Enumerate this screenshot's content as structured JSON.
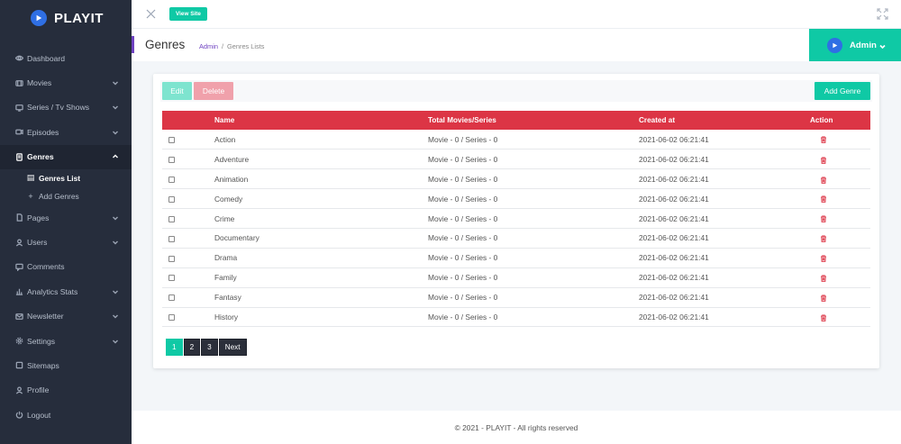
{
  "brand": {
    "name": "PLAYIT",
    "color": "#2f6fe4"
  },
  "sidebar": {
    "items": [
      {
        "label": "Dashboard",
        "icon": "eye-icon",
        "has_chevron": false
      },
      {
        "label": "Movies",
        "icon": "film-icon",
        "has_chevron": true
      },
      {
        "label": "Series / Tv Shows",
        "icon": "tv-icon",
        "has_chevron": true
      },
      {
        "label": "Episodes",
        "icon": "video-icon",
        "has_chevron": true
      },
      {
        "label": "Genres",
        "icon": "document-icon",
        "has_chevron": true,
        "active": true
      },
      {
        "label": "Pages",
        "icon": "file-icon",
        "has_chevron": true
      },
      {
        "label": "Users",
        "icon": "user-icon",
        "has_chevron": true
      },
      {
        "label": "Comments",
        "icon": "comment-icon",
        "has_chevron": false
      },
      {
        "label": "Analytics Stats",
        "icon": "bar-chart-icon",
        "has_chevron": true
      },
      {
        "label": "Newsletter",
        "icon": "mail-icon",
        "has_chevron": true
      },
      {
        "label": "Settings",
        "icon": "gear-icon",
        "has_chevron": true
      },
      {
        "label": "Sitemaps",
        "icon": "sitemap-icon",
        "has_chevron": false
      },
      {
        "label": "Profile",
        "icon": "user-icon",
        "has_chevron": false
      },
      {
        "label": "Logout",
        "icon": "power-icon",
        "has_chevron": false
      }
    ],
    "genres_sub": [
      {
        "label": "Genres List",
        "active": true
      },
      {
        "label": "Add Genres",
        "active": false
      }
    ]
  },
  "topbar": {
    "view_site_label": "View Site"
  },
  "header": {
    "title": "Genres",
    "breadcrumb_root": "Admin",
    "breadcrumb_sep": "/",
    "breadcrumb_current": "Genres Lists",
    "admin_label": "Admin"
  },
  "toolbar": {
    "edit_label": "Edit",
    "delete_label": "Delete",
    "add_label": "Add Genre"
  },
  "table": {
    "columns": [
      "Name",
      "Total Movies/Series",
      "Created at",
      "Action"
    ],
    "rows": [
      {
        "name": "Action",
        "total": "Movie - 0 / Series - 0",
        "created": "2021-06-02 06:21:41"
      },
      {
        "name": "Adventure",
        "total": "Movie - 0 / Series - 0",
        "created": "2021-06-02 06:21:41"
      },
      {
        "name": "Animation",
        "total": "Movie - 0 / Series - 0",
        "created": "2021-06-02 06:21:41"
      },
      {
        "name": "Comedy",
        "total": "Movie - 0 / Series - 0",
        "created": "2021-06-02 06:21:41"
      },
      {
        "name": "Crime",
        "total": "Movie - 0 / Series - 0",
        "created": "2021-06-02 06:21:41"
      },
      {
        "name": "Documentary",
        "total": "Movie - 0 / Series - 0",
        "created": "2021-06-02 06:21:41"
      },
      {
        "name": "Drama",
        "total": "Movie - 0 / Series - 0",
        "created": "2021-06-02 06:21:41"
      },
      {
        "name": "Family",
        "total": "Movie - 0 / Series - 0",
        "created": "2021-06-02 06:21:41"
      },
      {
        "name": "Fantasy",
        "total": "Movie - 0 / Series - 0",
        "created": "2021-06-02 06:21:41"
      },
      {
        "name": "History",
        "total": "Movie - 0 / Series - 0",
        "created": "2021-06-02 06:21:41"
      }
    ]
  },
  "pagination": {
    "pages": [
      "1",
      "2",
      "3"
    ],
    "current": "1",
    "next_label": "Next"
  },
  "footer": {
    "text": "© 2021 - PLAYIT - All rights reserved"
  },
  "colors": {
    "accent": "#0fc9a5",
    "danger": "#dc3545",
    "sidebar_bg": "#262d3c",
    "purple": "#6f42c1"
  }
}
